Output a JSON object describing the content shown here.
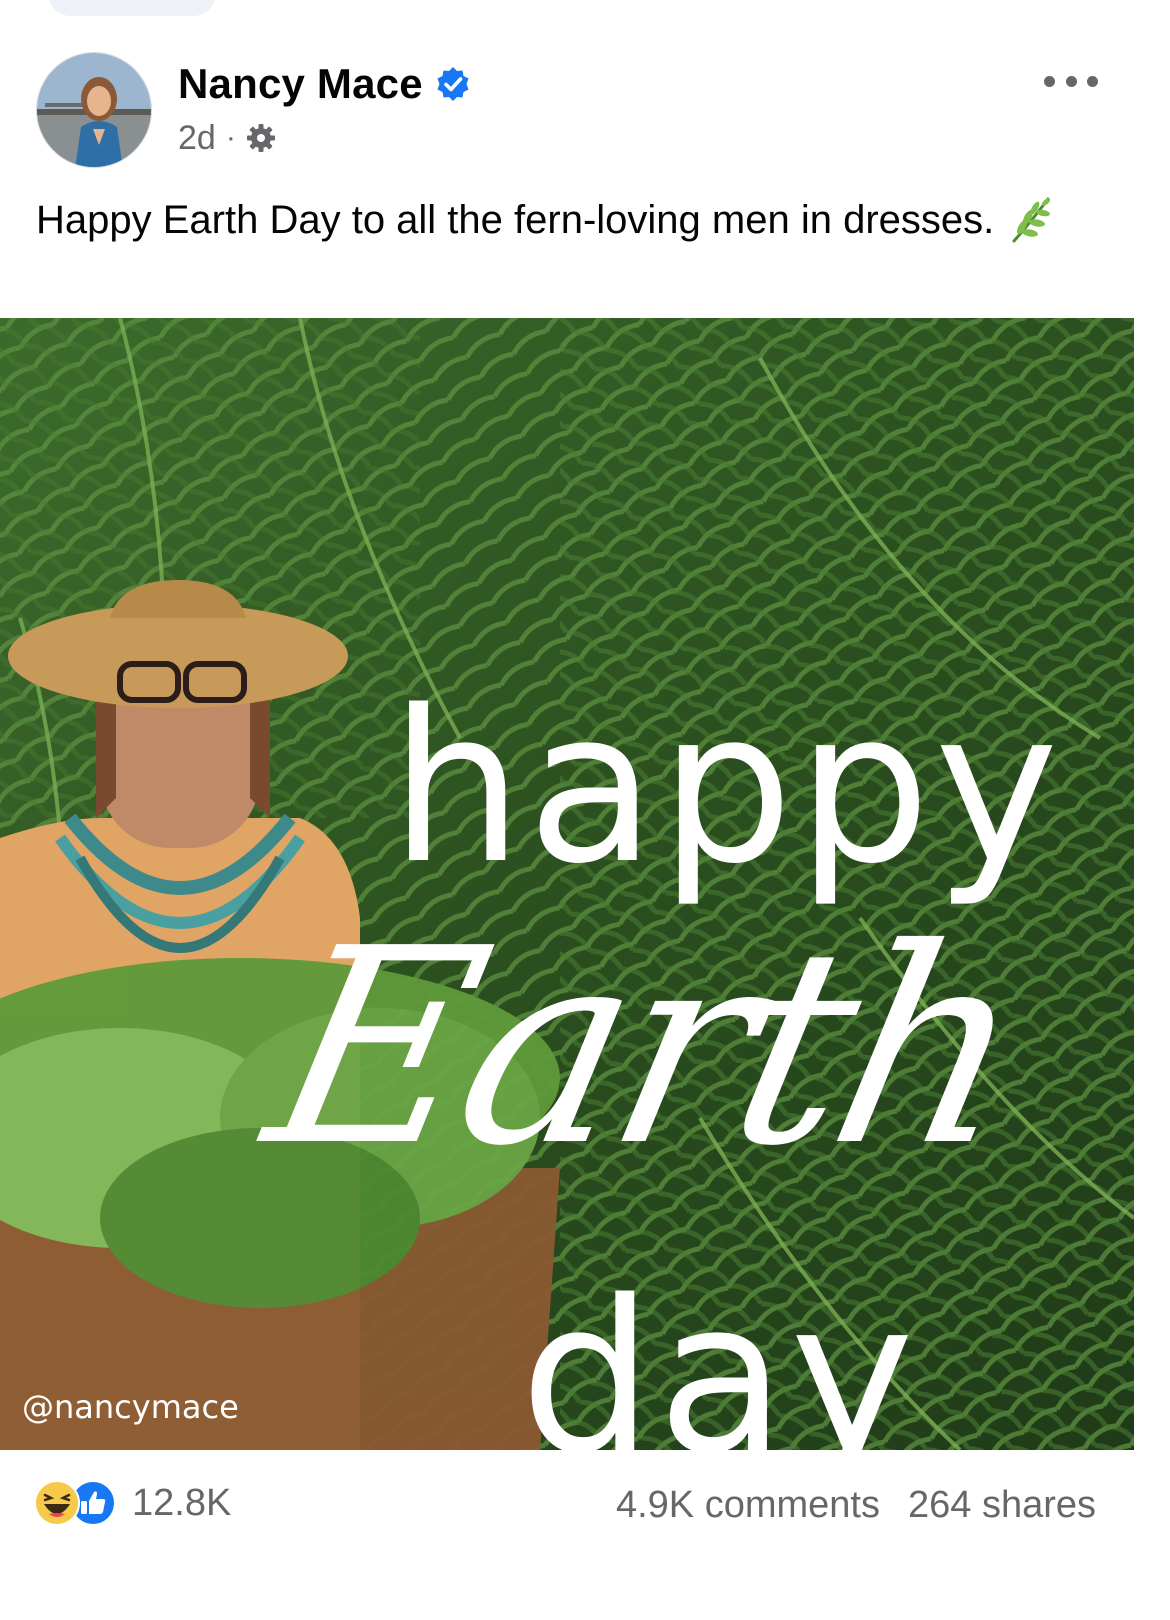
{
  "post": {
    "author": "Nancy Mace",
    "verified": true,
    "timestamp": "2d",
    "separator": "·",
    "audience_icon": "gear-icon",
    "more_icon": "more-options-icon",
    "text": "Happy Earth Day to all the fern-loving men in dresses.",
    "text_emoji_icon": "herb-leaf-icon"
  },
  "image": {
    "line1": "happy",
    "line2": "Earth",
    "line3": "day",
    "watermark": "@nancymace"
  },
  "engagement": {
    "reaction_icons": [
      "haha-reaction-icon",
      "like-reaction-icon"
    ],
    "reaction_count": "12.8K",
    "comments": "4.9K comments",
    "shares": "264 shares"
  },
  "colors": {
    "verified_blue": "#1877f2",
    "meta_gray": "#65676b",
    "fern_green": "#2f5a22"
  }
}
